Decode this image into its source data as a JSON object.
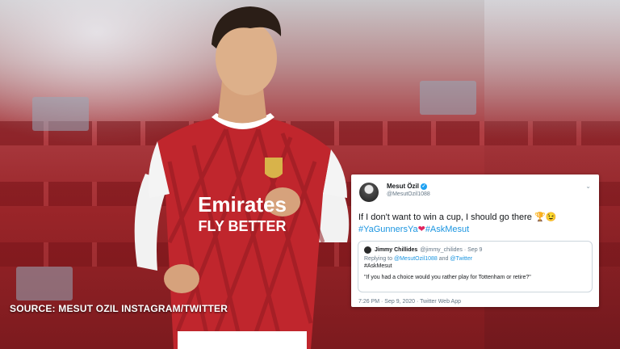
{
  "caption": "SOURCE: MESUT OZIL INSTAGRAM/TWITTER",
  "jersey": {
    "sponsor_line1": "Emirates",
    "sponsor_line2": "FLY BETTER"
  },
  "tweet": {
    "name": "Mesut Özil",
    "handle": "@MesutOzil1088",
    "text": "If I don't want to win a cup, I should go there 🏆😉",
    "hashtag1": "#YaGunnersYa",
    "hashtag2": "#AskMesut",
    "footer": "7:26 PM · Sep 9, 2020 · Twitter Web App",
    "icons": [
      "verified-badge-icon",
      "chevron-down-icon",
      "trophy-icon",
      "wink-icon",
      "heart-icon"
    ],
    "colors": {
      "link": "#1b95e0",
      "heart": "#e0245e",
      "verified": "#1da1f2"
    },
    "quoted": {
      "name": "Jimmy Chillides",
      "handle_date": "@jimmy_chilides · Sep 9",
      "replying_prefix": "Replying to",
      "replying_user1": "@MesutOzil1088",
      "replying_and": "and",
      "replying_user2": "@Twitter",
      "hashtag": "#AskMesut",
      "body": "\"If you had a choice would you rather play for Tottenham or retire?\""
    }
  }
}
